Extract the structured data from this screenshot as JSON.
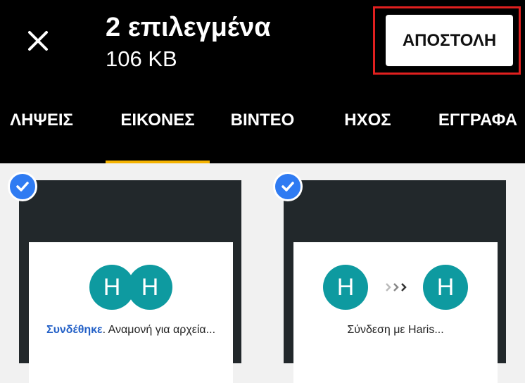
{
  "header": {
    "title": "2 επιλεγμένα",
    "subtitle": "106 KB",
    "send_label": "ΑΠΟΣΤΟΛΗ",
    "close_icon": "close-icon"
  },
  "tabs": [
    {
      "label": "ΛΗΨΕΙΣ",
      "selected": false
    },
    {
      "label": "ΕΙΚΟΝΕΣ",
      "selected": true
    },
    {
      "label": "ΒΙΝΤΕΟ",
      "selected": false
    },
    {
      "label": "ΗΧΟΣ",
      "selected": false
    },
    {
      "label": "ΕΓΓΡΑΦΑ",
      "selected": false
    }
  ],
  "items": [
    {
      "selected": true,
      "avatars": [
        "H",
        "H"
      ],
      "status_link": "Συνδέθηκε",
      "status_rest": ". Αναμονή για αρχεία..."
    },
    {
      "selected": true,
      "avatars": [
        "H",
        "H"
      ],
      "status_text": "Σύνδεση με Haris..."
    }
  ],
  "colors": {
    "topbar": "#000000",
    "accent_underline": "#f5b300",
    "highlight_outline": "#e0201f",
    "check_blue": "#2f7bf2",
    "avatar_teal": "#0e9aa0",
    "link_blue": "#2461c7"
  }
}
